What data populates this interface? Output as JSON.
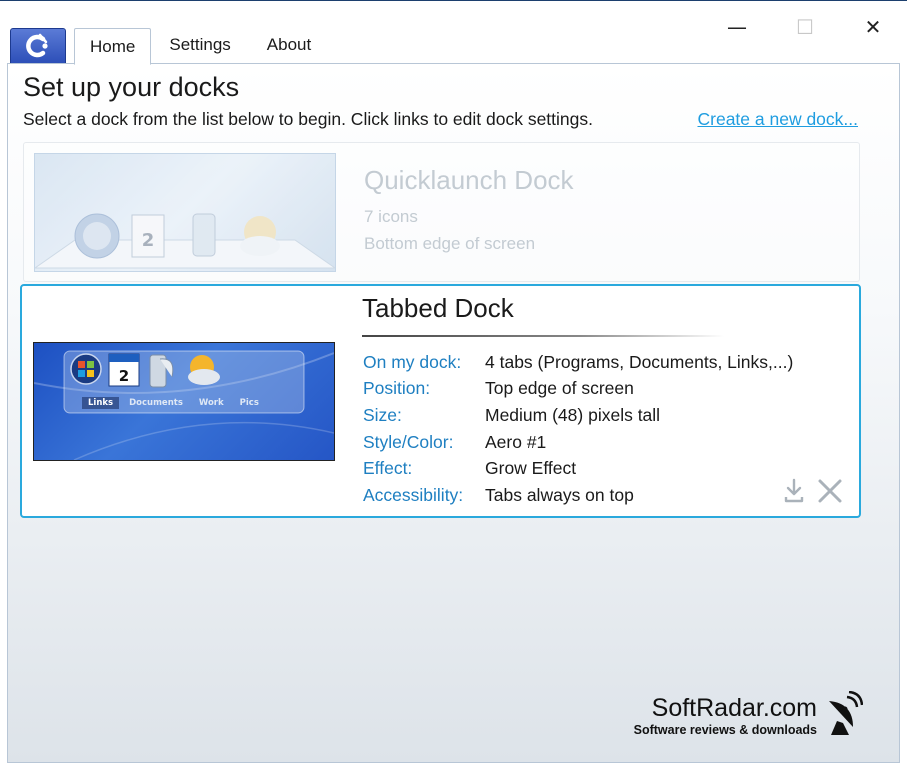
{
  "app": {
    "logo_icon": "app-logo-icon",
    "brand_color": "#2d4fb8"
  },
  "window_controls": {
    "minimize": "—",
    "maximize": "☐",
    "close": "✕"
  },
  "tabs": [
    {
      "label": "Home",
      "active": true
    },
    {
      "label": "Settings",
      "active": false
    },
    {
      "label": "About",
      "active": false
    }
  ],
  "main": {
    "heading": "Set up your docks",
    "subtitle": "Select a dock from the list below to begin. Click links to edit dock settings.",
    "create_link": "Create a new dock..."
  },
  "docks": [
    {
      "name": "Quicklaunch Dock",
      "info": [
        "7 icons",
        "Bottom edge of screen"
      ],
      "selected": false
    },
    {
      "name": "Tabbed Dock",
      "selected": true,
      "preview_tabs": [
        "Links",
        "Documents",
        "Work",
        "Pics"
      ],
      "properties": [
        {
          "label": "On my dock:",
          "value": "4 tabs (Programs, Documents, Links,...)"
        },
        {
          "label": "Position:",
          "value": "Top edge of screen"
        },
        {
          "label": "Size:",
          "value": "Medium (48) pixels tall"
        },
        {
          "label": "Style/Color:",
          "value": "Aero #1"
        },
        {
          "label": "Effect:",
          "value": "Grow Effect"
        },
        {
          "label": "Accessibility:",
          "value": "Tabs always on top"
        }
      ],
      "actions": [
        "download-icon",
        "remove-icon"
      ]
    }
  ],
  "watermark": {
    "title": "SoftRadar.com",
    "subtitle": "Software reviews & downloads",
    "icon": "satellite-dish-icon"
  },
  "colors": {
    "link": "#1f9de0",
    "label": "#1e7fc1",
    "selection_border": "#2aa9dd"
  }
}
